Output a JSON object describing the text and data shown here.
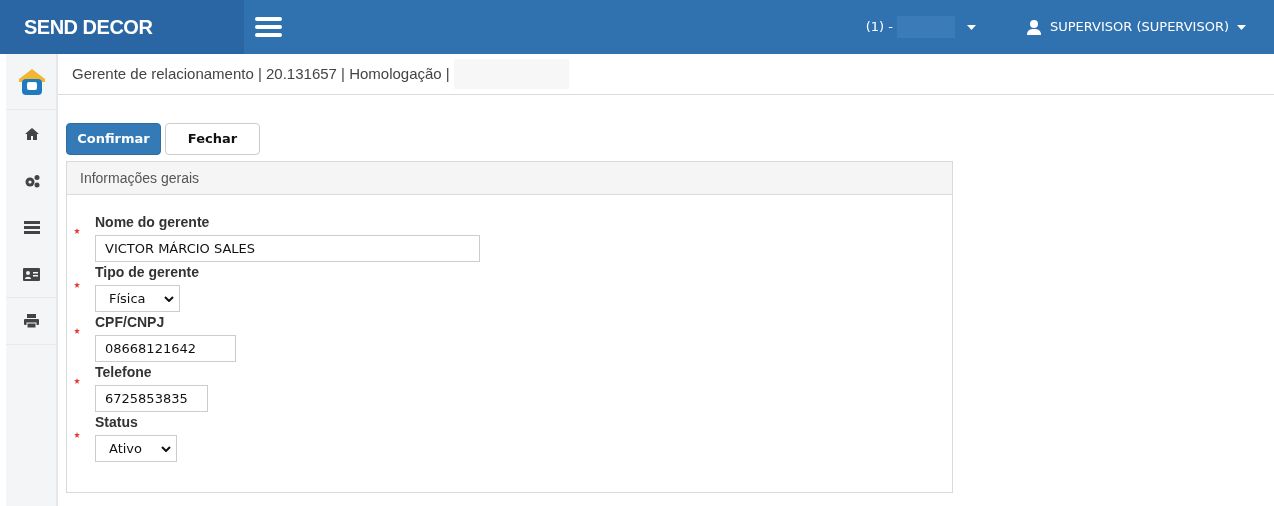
{
  "header": {
    "brand": "SEND DECOR",
    "context": "(1) -",
    "user": "SUPERVISOR (SUPERVISOR)"
  },
  "breadcrumb": "Gerente de relacionamento | 20.131657 | Homologação |",
  "buttons": [
    {
      "label": "Confirmar",
      "kind": "primary"
    },
    {
      "label": "Fechar",
      "kind": "default"
    }
  ],
  "panel": {
    "title": "Informações gerais",
    "fields": [
      {
        "label": "Nome do gerente",
        "kind": "text",
        "value": "VICTOR MÁRCIO SALES",
        "required": true
      },
      {
        "label": "Tipo de gerente",
        "kind": "select",
        "value": "Física",
        "required": true
      },
      {
        "label": "CPF/CNPJ",
        "kind": "text",
        "value": "08668121642",
        "required": true
      },
      {
        "label": "Telefone",
        "kind": "text",
        "value": "6725853835",
        "required": true
      },
      {
        "label": "Status",
        "kind": "select",
        "value": "Ativo",
        "required": true
      }
    ]
  }
}
